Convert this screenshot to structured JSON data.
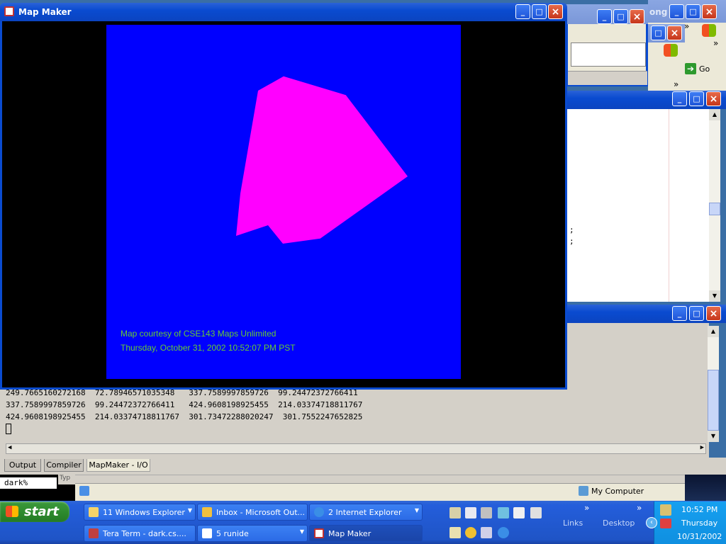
{
  "map_window": {
    "title": "Map Maker",
    "credit": "Map courtesy of CSE143 Maps Unlimited",
    "timestamp": "Thursday, October 31, 2002 10:52:07 PM PST",
    "colors": {
      "map_bg": "#0000ff",
      "polygon": "#ff00ff",
      "text": "#66cc33"
    }
  },
  "background_windows": {
    "partial_title": "ong",
    "go_label": "Go",
    "chevron": "»",
    "code_semicolons": [
      ";",
      ";"
    ]
  },
  "console": {
    "lines": [
      "249.7665160272168  72.78946571035348   337.7589997859726  99.24472372766411",
      "337.7589997859726  99.24472372766411   424.9608198925455  214.03374718811767",
      "424.9608198925455  214.03374718811767  301.73472288020247  301.7552247652825"
    ],
    "tabs": [
      {
        "label": "Output",
        "active": false
      },
      {
        "label": "Compiler",
        "active": false
      },
      {
        "label": "MapMaker - I/O",
        "active": true
      }
    ]
  },
  "terminal": {
    "prompt": "dark%",
    "partial": "Typ"
  },
  "status_bar": {
    "label": "My Computer"
  },
  "taskbar": {
    "start_label": "start",
    "tasks_row1": [
      {
        "label": "11 Windows Explorer",
        "icon": "folder-icon",
        "dropdown": true
      },
      {
        "label": "Inbox - Microsoft Out...",
        "icon": "outlook-icon",
        "dropdown": false
      },
      {
        "label": "2 Internet Explorer",
        "icon": "ie-icon",
        "dropdown": true
      }
    ],
    "tasks_row2": [
      {
        "label": "Tera Term - dark.cs....",
        "icon": "teraterm-icon",
        "dropdown": false
      },
      {
        "label": "5 runide",
        "icon": "window-icon",
        "dropdown": true
      },
      {
        "label": "Map Maker",
        "icon": "mapmaker-icon",
        "dropdown": false,
        "active": true
      }
    ],
    "toolbars": {
      "links": "Links",
      "desktop": "Desktop",
      "chevron": "»"
    },
    "clock": {
      "time": "10:52 PM",
      "day": "Thursday",
      "date": "10/31/2002"
    }
  }
}
